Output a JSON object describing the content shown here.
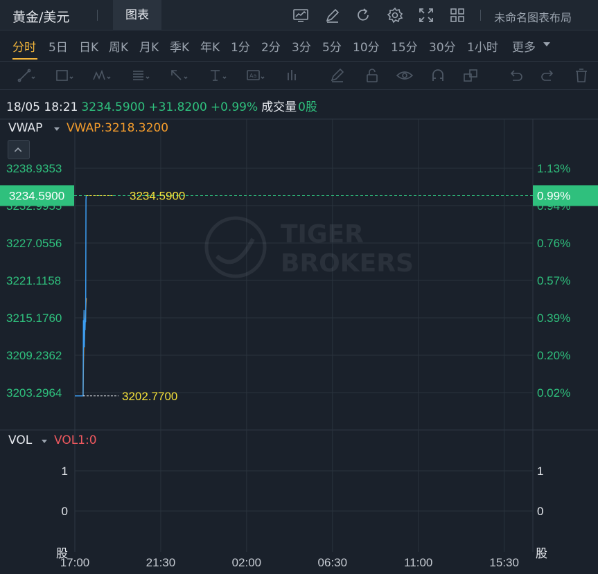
{
  "header": {
    "symbol": "黄金/美元",
    "chart_tab": "图表",
    "layout_name": "未命名图表布局",
    "icons": [
      "indicator-icon",
      "draw-icon",
      "refresh-icon",
      "settings-icon",
      "fullscreen-icon",
      "layout-grid-icon"
    ]
  },
  "periods": {
    "items": [
      "分时",
      "5日",
      "日K",
      "周K",
      "月K",
      "季K",
      "年K",
      "1分",
      "2分",
      "3分",
      "5分",
      "10分",
      "15分",
      "30分",
      "1小时",
      "更多"
    ],
    "active": "分时"
  },
  "tools": [
    "trend-line-icon",
    "rectangle-icon",
    "pattern-icon",
    "fib-icon",
    "arrow-icon",
    "text-icon",
    "label-icon",
    "bars-icon",
    "pencil-icon",
    "lock-icon",
    "eye-icon",
    "magnet-icon",
    "layers-icon",
    "undo-icon",
    "redo-icon",
    "trash-icon"
  ],
  "info": {
    "datetime": "18/05 18:21",
    "price": "3234.5900",
    "change": "+31.8200",
    "change_pct": "+0.99%",
    "volume_label": "成交量",
    "volume": "0股"
  },
  "indicators": {
    "main_name": "VWAP",
    "main_value": "VWAP:3218.3200",
    "sub_name": "VOL",
    "sub_value": "VOL1:0"
  },
  "watermark": {
    "line1": "TIGER",
    "line2": "BROKERS"
  },
  "colors": {
    "background": "#1a212b",
    "price_line": "#3b9cf0",
    "vwap_line": "#f39c2c",
    "up": "#2fc07d",
    "grid": "#2a333d",
    "marker_text": "#f7e33a"
  },
  "chart_data": {
    "type": "line",
    "title": "",
    "x_ticks": [
      "17:00",
      "21:30",
      "02:00",
      "06:30",
      "11:00",
      "15:30"
    ],
    "y_ticks_left": [
      "3238.9353",
      "3232.9955",
      "3227.0556",
      "3221.1158",
      "3215.1760",
      "3209.2362",
      "3203.2964"
    ],
    "y_tick_values": [
      3238.9353,
      3232.9955,
      3227.0556,
      3221.1158,
      3215.176,
      3209.2362,
      3203.2964
    ],
    "y_ticks_right": [
      "1.13%",
      "0.94%",
      "0.76%",
      "0.57%",
      "0.39%",
      "0.20%",
      "0.02%"
    ],
    "ylim": [
      3199.3,
      3242.9
    ],
    "x_range_minutes": [
      0,
      1440
    ],
    "current_price": {
      "label": "3234.5900",
      "pct": "0.99%",
      "value": 3234.59
    },
    "high_marker": {
      "label": "3234.5900",
      "value": 3234.59
    },
    "low_marker": {
      "label": "3202.7700",
      "value": 3202.77
    },
    "series": [
      {
        "name": "",
        "color": "#3b9cf0",
        "points": [
          [
            0,
            3202.77
          ],
          [
            26,
            3202.77
          ],
          [
            27,
            3214.8
          ],
          [
            28,
            3212.5
          ],
          [
            29,
            3216.4
          ],
          [
            30,
            3210.5
          ],
          [
            31,
            3214.0
          ],
          [
            32,
            3213.2
          ],
          [
            33,
            3215.1
          ],
          [
            34,
            3214.5
          ],
          [
            35,
            3233.9
          ],
          [
            36,
            3234.59
          ]
        ]
      },
      {
        "name": "",
        "color": "#f39c2c",
        "points": [
          [
            0,
            3202.77
          ],
          [
            26,
            3202.77
          ],
          [
            27,
            3208.0
          ],
          [
            28,
            3211.0
          ],
          [
            29,
            3213.0
          ],
          [
            30,
            3211.5
          ],
          [
            31,
            3213.5
          ],
          [
            32,
            3214.2
          ],
          [
            33,
            3214.8
          ],
          [
            34,
            3216.0
          ],
          [
            35,
            3217.5
          ],
          [
            36,
            3218.32
          ]
        ]
      }
    ],
    "volume": {
      "y_ticks_left": [
        "1",
        "0"
      ],
      "y_ticks_right": [
        "1",
        "0"
      ],
      "unit": "股",
      "values": []
    }
  }
}
